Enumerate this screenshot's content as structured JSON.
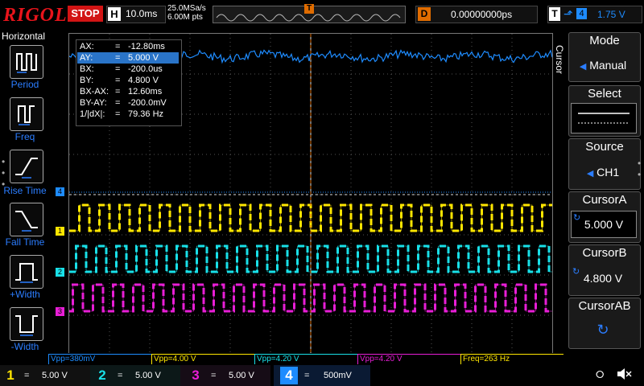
{
  "topbar": {
    "brand": "RIGOL",
    "run_state": "STOP",
    "horizontal_label": "H",
    "timebase": "10.0ms",
    "sample_rate": "25.0MSa/s",
    "memory_depth": "6.00M pts",
    "delay_label": "D",
    "delay_value": "0.00000000ps",
    "trigger_label": "T",
    "trigger_source": "4",
    "trigger_level": "1.75 V",
    "trigger_position_marker": "T"
  },
  "left_panel": {
    "title": "Horizontal",
    "buttons": [
      {
        "label": "Period",
        "icon": "period-icon"
      },
      {
        "label": "Freq",
        "icon": "frequency-icon"
      },
      {
        "label": "Rise Time",
        "icon": "rise-time-icon"
      },
      {
        "label": "Fall Time",
        "icon": "fall-time-icon"
      },
      {
        "label": "+Width",
        "icon": "positive-width-icon"
      },
      {
        "label": "-Width",
        "icon": "negative-width-icon"
      }
    ]
  },
  "cursor_readout": [
    {
      "name": "AX:",
      "value": "-12.80ms",
      "selected": false
    },
    {
      "name": "AY:",
      "value": "5.000 V",
      "selected": true
    },
    {
      "name": "BX:",
      "value": "-200.0us",
      "selected": false
    },
    {
      "name": "BY:",
      "value": "4.800 V",
      "selected": false
    },
    {
      "name": "BX-AX:",
      "value": "12.60ms",
      "selected": false
    },
    {
      "name": "BY-AY:",
      "value": "-200.0mV",
      "selected": false
    },
    {
      "name": "1/|dX|:",
      "value": "79.36 Hz",
      "selected": false
    }
  ],
  "cursor_eq": "=",
  "right_panel": {
    "menu_title": "Cursor",
    "mode_title": "Mode",
    "mode_value": "Manual",
    "select_title": "Select",
    "source_title": "Source",
    "source_value": "CH1",
    "cursor_a_title": "CursorA",
    "cursor_a_value": "5.000 V",
    "cursor_b_title": "CursorB",
    "cursor_b_value": "4.800 V",
    "cursor_ab_title": "CursorAB"
  },
  "channel_markers": {
    "ch1": "1",
    "ch2": "2",
    "ch3": "3",
    "ch4": "4"
  },
  "measurements": [
    {
      "text": "Vpp=380mV",
      "color": "#1e8cff"
    },
    {
      "text": "Vpp=4.00 V",
      "color": "#ffe600"
    },
    {
      "text": "Vpp=4.20 V",
      "color": "#19e0e8"
    },
    {
      "text": "Vpp=4.20 V",
      "color": "#e81ed6"
    },
    {
      "text": "Freq=263 Hz",
      "color": "#ffe600"
    }
  ],
  "channels": [
    {
      "num": "1",
      "coupling": "=",
      "scale": "5.00 V",
      "color": "#ffe600"
    },
    {
      "num": "2",
      "coupling": "=",
      "scale": "5.00 V",
      "color": "#19e0e8"
    },
    {
      "num": "3",
      "coupling": "=",
      "scale": "5.00 V",
      "color": "#e81ed6"
    },
    {
      "num": "4",
      "coupling": "=",
      "scale": "500mV",
      "color": "#1e8cff"
    }
  ],
  "status_icons": [
    "usb-icon",
    "sound-icon"
  ],
  "colors": {
    "ch1": "#ffe600",
    "ch2": "#19e0e8",
    "ch3": "#e81ed6",
    "ch4": "#1e8cff",
    "stop": "#d21414",
    "delay": "#e06c00"
  }
}
